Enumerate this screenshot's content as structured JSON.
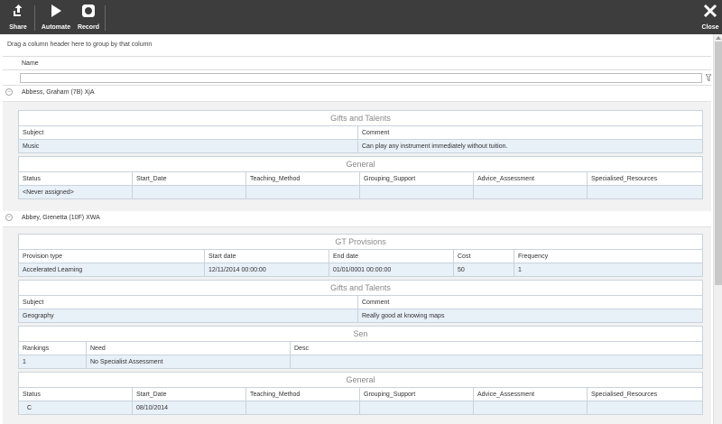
{
  "toolbar": {
    "share": "Share",
    "automate": "Automate",
    "record": "Record",
    "close": "Close"
  },
  "grid": {
    "group_hint": "Drag a column header here to group by that column",
    "column_name": "Name",
    "filter_value": ""
  },
  "groups": [
    {
      "name": "Abbess, Graham (7B) XjA",
      "gifts": {
        "title": "Gifts and Talents",
        "headers": [
          "Subject",
          "Comment"
        ],
        "row": [
          "Music",
          "Can play any instrument immediately without tuition."
        ]
      },
      "general": {
        "title": "General",
        "headers": [
          "Status",
          "Start_Date",
          "Teaching_Method",
          "Grouping_Support",
          "Advice_Assessment",
          "Specialised_Resources"
        ],
        "row": [
          "<Never assigned>",
          "",
          "",
          "",
          "",
          ""
        ]
      }
    },
    {
      "name": "Abbey, Grenetta (10F) XWA",
      "provisions": {
        "title": "GT Provisions",
        "headers": [
          "Provision type",
          "Start date",
          "End date",
          "Cost",
          "Frequency"
        ],
        "row": [
          "Accelerated Learning",
          "12/11/2014 00:00:00",
          "01/01/0001 00:00:00",
          "50",
          "1"
        ]
      },
      "gifts": {
        "title": "Gifts and Talents",
        "headers": [
          "Subject",
          "Comment"
        ],
        "row": [
          "Geography",
          "Really good at knowing maps"
        ]
      },
      "sen": {
        "title": "Sen",
        "headers": [
          "Rankings",
          "Need",
          "Desc"
        ],
        "row": [
          "1",
          "No Specialist Assessment",
          ""
        ]
      },
      "general": {
        "title": "General",
        "headers": [
          "Status",
          "Start_Date",
          "Teaching_Method",
          "Grouping_Support",
          "Advice_Assessment",
          "Specialised_Resources"
        ],
        "row": [
          "C",
          "08/10/2014",
          "",
          "",
          "",
          ""
        ]
      }
    }
  ]
}
